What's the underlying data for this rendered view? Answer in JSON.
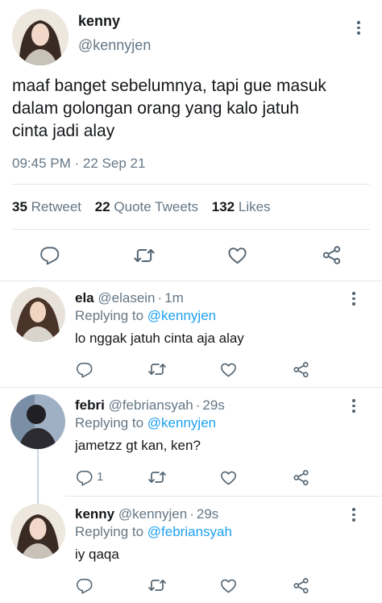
{
  "main_tweet": {
    "display_name": "kenny",
    "handle": "@kennyjen",
    "text_lines": [
      "maaf banget sebelumnya, tapi gue masuk",
      "dalam golongan orang yang kalo jatuh",
      "cinta jadi alay"
    ],
    "time": "09:45 PM",
    "separator": "·",
    "date": "22 Sep 21",
    "stats": {
      "retweets_count": "35",
      "retweets_label": "Retweet",
      "quotes_count": "22",
      "quotes_label": "Quote Tweets",
      "likes_count": "132",
      "likes_label": "Likes"
    }
  },
  "replies": [
    {
      "name": "ela",
      "handle": "@elasein",
      "sep": "·",
      "time": "1m",
      "replying_prefix": "Replying to",
      "replying_to": "@kennyjen",
      "text": "lo nggak jatuh cinta aja alay",
      "reply_count": ""
    },
    {
      "name": "febri",
      "handle": "@febriansyah",
      "sep": "·",
      "time": "29s",
      "replying_prefix": "Replying to",
      "replying_to": "@kennyjen",
      "text": "jametzz gt kan, ken?",
      "reply_count": "1"
    },
    {
      "name": "kenny",
      "handle": "@kennyjen",
      "sep": "·",
      "time": "29s",
      "replying_prefix": "Replying to",
      "replying_to": "@febriansyah",
      "text": "iy qaqa",
      "reply_count": ""
    }
  ],
  "icons": [
    "reply-icon",
    "retweet-icon",
    "like-icon",
    "share-icon",
    "more-options-icon"
  ],
  "colors": {
    "text": "#14171a",
    "muted": "#657786",
    "link": "#1da1f2",
    "icon": "#536471",
    "divider": "#e1e8ed"
  }
}
